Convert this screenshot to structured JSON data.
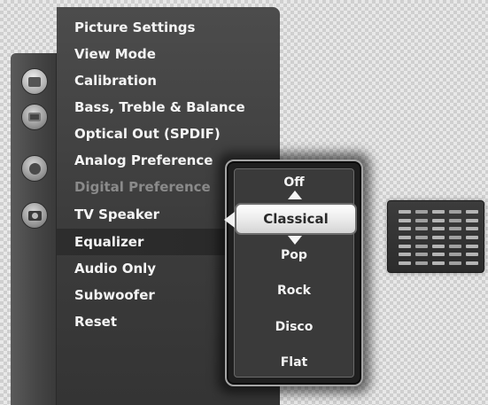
{
  "menu": {
    "items": [
      {
        "label": "Picture Settings",
        "enabled": true
      },
      {
        "label": "View Mode",
        "enabled": true
      },
      {
        "label": "Calibration",
        "enabled": true
      },
      {
        "label": "Bass, Treble & Balance",
        "enabled": true
      },
      {
        "label": "Optical Out (SPDIF)",
        "enabled": true
      },
      {
        "label": "Analog Preference",
        "enabled": true
      },
      {
        "label": "Digital Preference",
        "enabled": false
      },
      {
        "label": "TV Speaker",
        "enabled": true
      },
      {
        "label": "Equalizer",
        "enabled": true,
        "highlighted": true
      },
      {
        "label": "Audio Only",
        "enabled": true
      },
      {
        "label": "Subwoofer",
        "enabled": true
      },
      {
        "label": "Reset",
        "enabled": true
      }
    ]
  },
  "equalizer_popup": {
    "options": [
      "Off",
      "Classical",
      "Pop",
      "Rock",
      "Disco",
      "Flat"
    ],
    "selected": "Classical"
  },
  "rail": {
    "icons": [
      "picture-icon",
      "tv-icon",
      "settings-gears-icon",
      "camera-icon"
    ],
    "active": "picture-icon"
  },
  "side_icon": "equalizer-icon"
}
